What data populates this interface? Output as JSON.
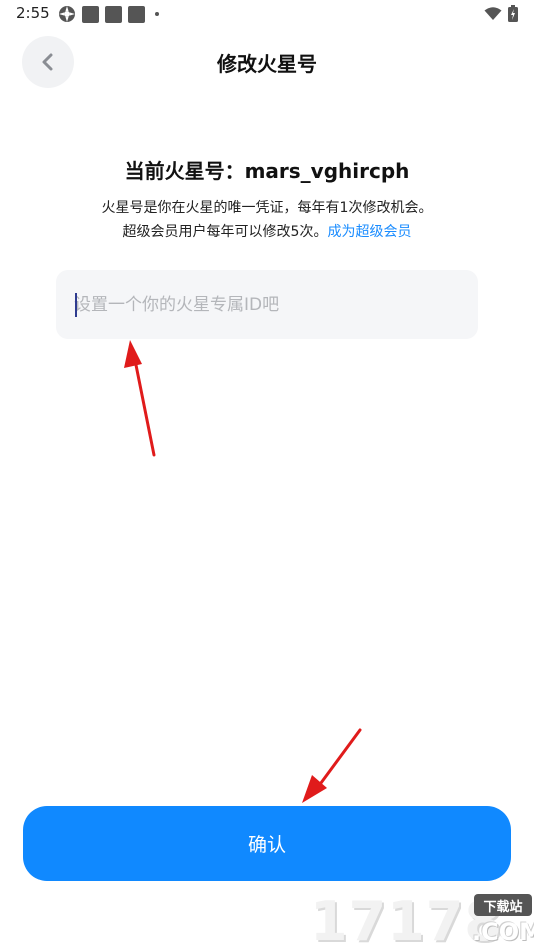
{
  "status_bar": {
    "time": "2:55",
    "icons": [
      "settings-icon",
      "notification-icon",
      "notification-icon",
      "notification-icon",
      "dot-icon",
      "wifi-icon",
      "battery-icon"
    ]
  },
  "header": {
    "title": "修改火星号",
    "back_icon": "chevron-left-icon"
  },
  "current": {
    "label": "当前火星号：mars_vghircph"
  },
  "description": {
    "line1": "火星号是你在火星的唯一凭证，每年有1次修改机会。",
    "line2": "超级会员用户每年可以修改5次。",
    "link": "成为超级会员"
  },
  "input": {
    "placeholder": "设置一个你的火星专属ID吧",
    "value": ""
  },
  "confirm": {
    "label": "确认"
  },
  "watermark": {
    "digits": "17178",
    "badge": "下载站",
    "com": ".COM"
  },
  "colors": {
    "accent": "#1089ff",
    "link": "#1a8cff",
    "annotation_arrow": "#e01b1b",
    "input_bg": "#f5f6f8"
  }
}
